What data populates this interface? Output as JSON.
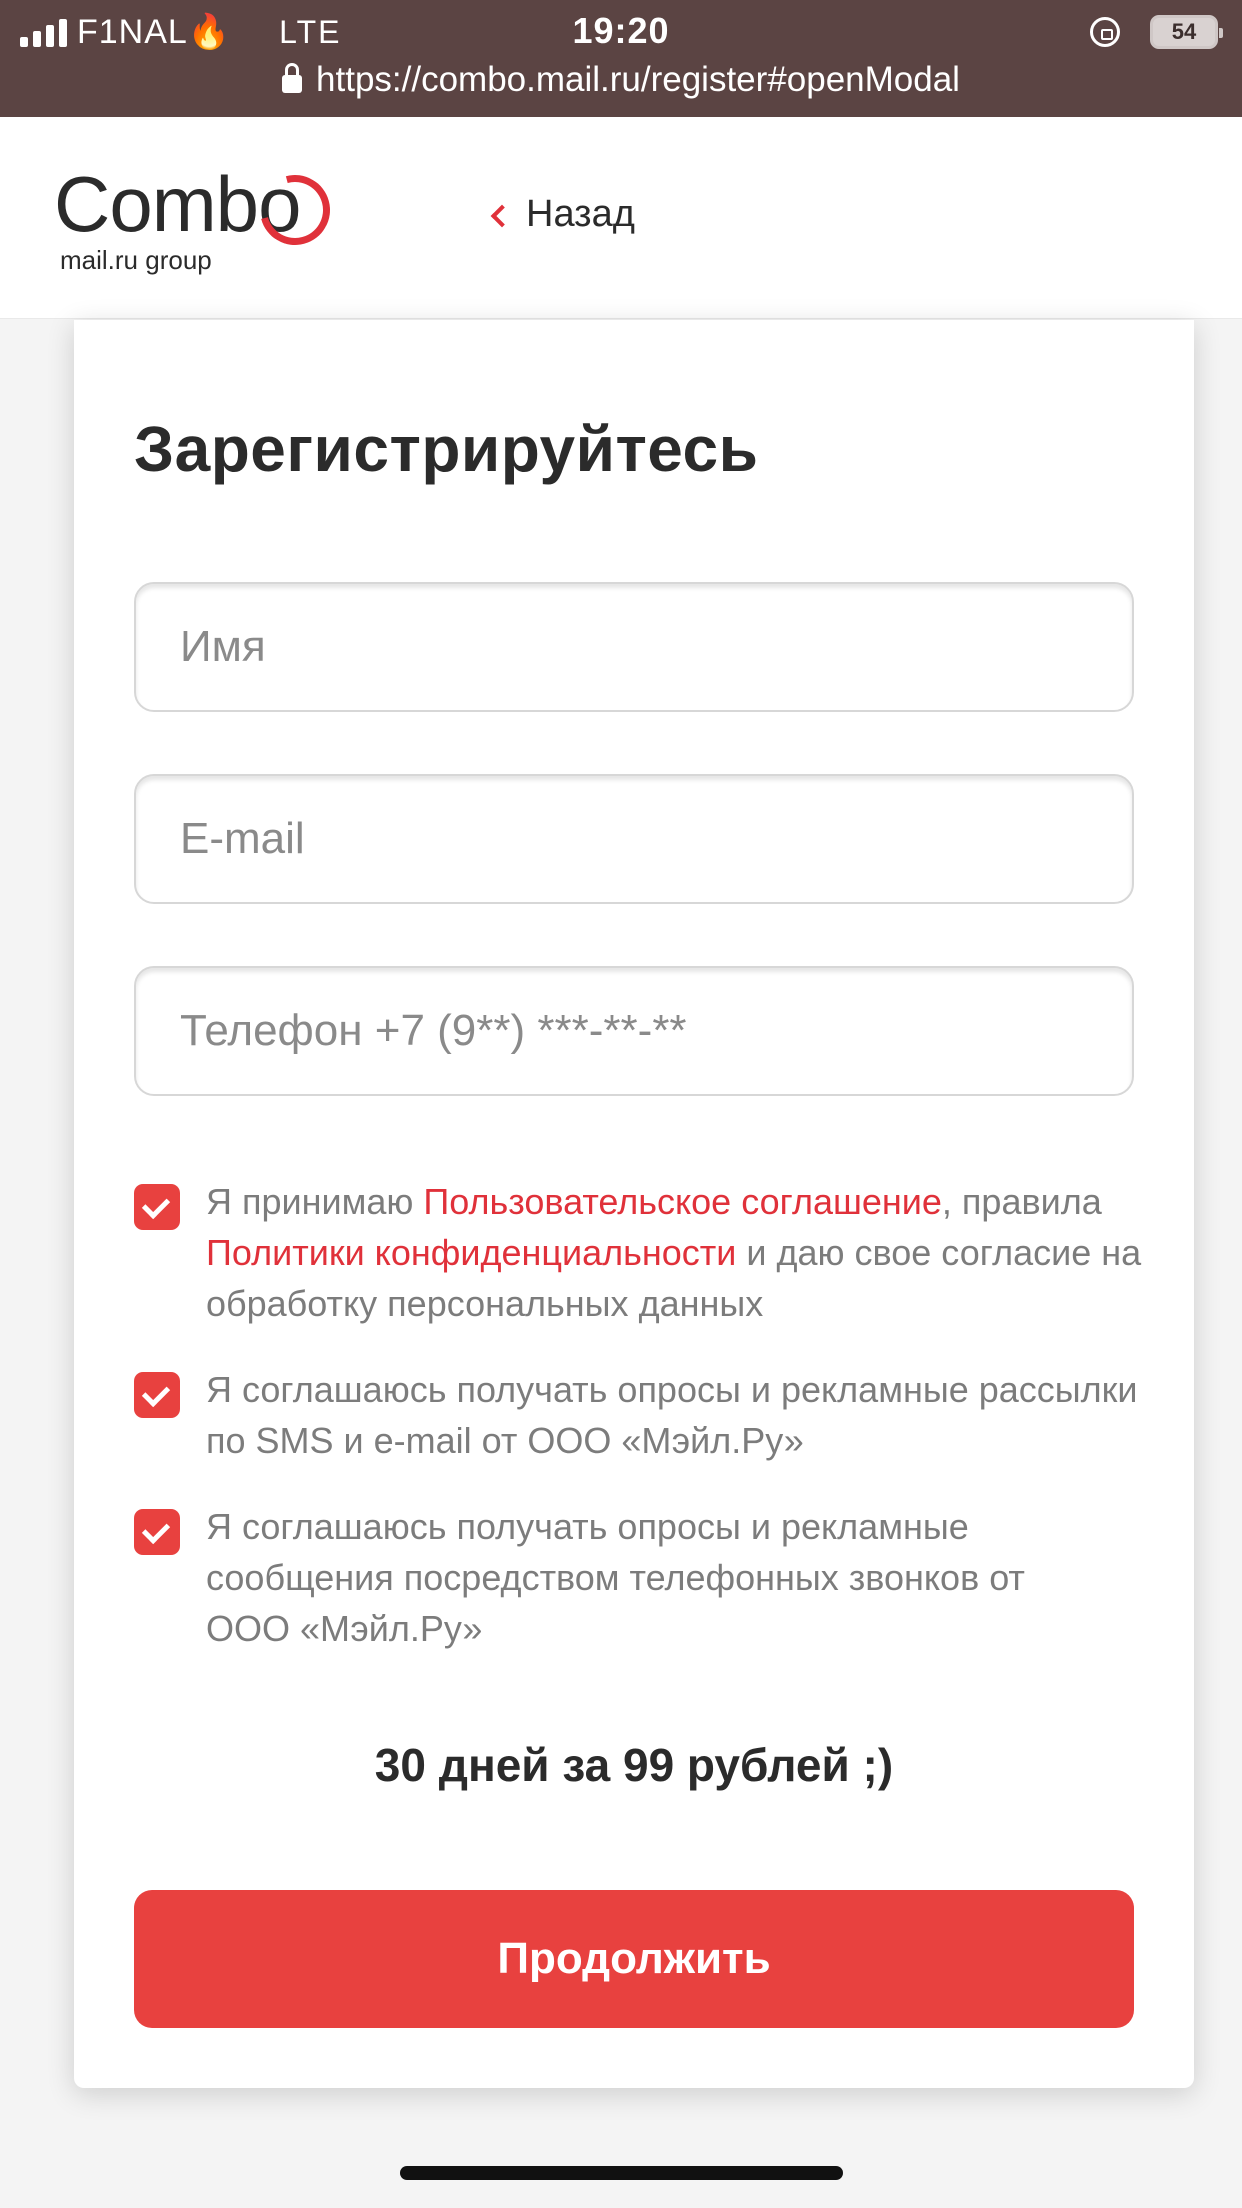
{
  "status_bar": {
    "carrier": "F1NAL🔥",
    "network": "LTE",
    "time": "19:20",
    "battery": "54"
  },
  "browser": {
    "url": "https://combo.mail.ru/register#openModal"
  },
  "header": {
    "logo_text": "Combo",
    "logo_subtext": "mail.ru group",
    "back_label": "Назад"
  },
  "form": {
    "title": "Зарегистрируйтесь",
    "name_placeholder": "Имя",
    "name_value": "",
    "email_placeholder": "E-mail",
    "email_value": "",
    "phone_placeholder": "Телефон +7 (9**) ***-**-**",
    "phone_value": "",
    "consents": [
      {
        "checked": true,
        "text_1": "Я принимаю ",
        "link_1": "Пользовательское соглашение",
        "text_2": ", правила ",
        "link_2": "Политики конфиденциальности",
        "text_3": " и даю свое согласие на обработку персональных данных"
      },
      {
        "checked": true,
        "text": "Я соглашаюсь получать опросы и рекламные рассылки по SMS и e-mail от ООО «Мэйл.Ру»"
      },
      {
        "checked": true,
        "text": "Я соглашаюсь получать опросы и рекламные сообщения посредством телефонных звонков от ООО «Мэйл.Ру»"
      }
    ],
    "promo": "30 дней за 99 рублей ;)",
    "submit_label": "Продолжить"
  },
  "colors": {
    "accent": "#e8413f",
    "link": "#e0313a",
    "status_bar_bg": "#5b4443"
  }
}
